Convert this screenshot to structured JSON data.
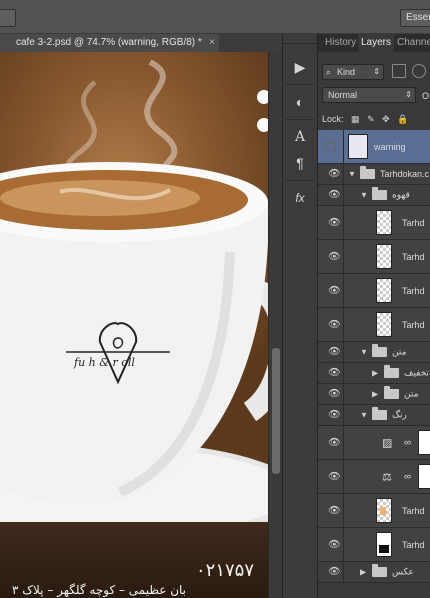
{
  "topbar": {
    "left_label": "",
    "right_label": "Esser"
  },
  "document": {
    "tab_title": "cafe 3-2.psd @ 74.7% (warning, RGB/8) *",
    "close": "×"
  },
  "canvas": {
    "phone": "۰۲۱۷۵۷",
    "address": "بان عظیمی – کوچه گلگهر – پلاک ۳"
  },
  "tools": [
    "play-icon",
    "adjust-icon",
    "text-icon",
    "paragraph-icon",
    "fx-icon"
  ],
  "panel": {
    "tabs": [
      "History",
      "Layers",
      "Channel"
    ],
    "active_tab": "Layers",
    "filter_label": "Kind",
    "blend_mode": "Normal",
    "blend_extra": "O",
    "lock_label": "Lock:"
  },
  "layers": [
    {
      "type": "layer",
      "name": "warning",
      "selected": true,
      "visible": false,
      "thumb": "smart"
    },
    {
      "type": "group",
      "name": "Tarhdokan.c",
      "visible": true,
      "open": true,
      "indent": 0
    },
    {
      "type": "group",
      "name": "قهوه",
      "visible": true,
      "open": true,
      "indent": 1
    },
    {
      "type": "layer",
      "name": "Tarhd",
      "visible": true,
      "thumb": "checker"
    },
    {
      "type": "layer",
      "name": "Tarhd",
      "visible": true,
      "thumb": "checker"
    },
    {
      "type": "layer",
      "name": "Tarhd",
      "visible": true,
      "thumb": "checker"
    },
    {
      "type": "layer",
      "name": "Tarhd",
      "visible": true,
      "thumb": "checker"
    },
    {
      "type": "group",
      "name": "متن",
      "visible": true,
      "open": true,
      "indent": 1
    },
    {
      "type": "group",
      "name": "تخفیف",
      "visible": true,
      "open": false,
      "indent": 2
    },
    {
      "type": "group",
      "name": "متن",
      "visible": true,
      "open": false,
      "indent": 2
    },
    {
      "type": "group",
      "name": "رنگ",
      "visible": true,
      "open": true,
      "indent": 1
    },
    {
      "type": "adjust",
      "name": "",
      "visible": true,
      "icon": "▨"
    },
    {
      "type": "adjust",
      "name": "",
      "visible": true,
      "icon": "⚖"
    },
    {
      "type": "layer",
      "name": "Tarhd",
      "visible": true,
      "thumb": "orange"
    },
    {
      "type": "layer",
      "name": "Tarhd",
      "visible": true,
      "thumb": "dark"
    },
    {
      "type": "group",
      "name": "عکس",
      "visible": true,
      "open": false,
      "indent": 1
    }
  ]
}
